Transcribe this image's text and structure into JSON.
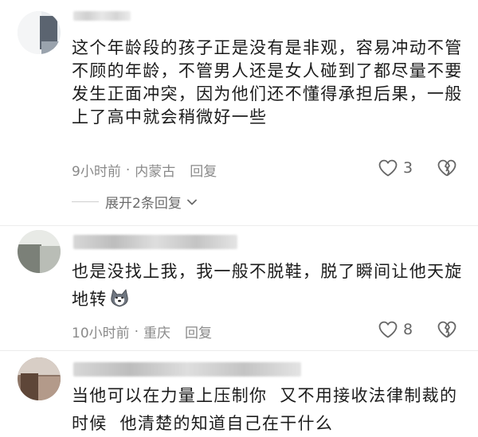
{
  "comments": [
    {
      "text_lines": [
        "这个年龄段的孩子正是没有是非观，容易冲动不管",
        "不顾的年龄，不管男人还是女人碰到了都尽量不要",
        "发生正面冲突，因为他们还不懂得承担后果，一般",
        "上了高中就会稍微好一些"
      ],
      "time": "9小时前",
      "location": "内蒙古",
      "reply_label": "回复",
      "likes": "3",
      "expand_label": "展开2条回复"
    },
    {
      "text_lines": [
        "也是没找上我，我一般不脱鞋，脱了瞬间让他天旋",
        "地转"
      ],
      "time": "10小时前",
      "location": "重庆",
      "reply_label": "回复",
      "likes": "8"
    },
    {
      "text_lines": [
        "当他可以在力量上压制你  又不用接收法律制裁的",
        "时候  他清楚的知道自己在干什么"
      ]
    }
  ],
  "separator": "·",
  "icons": {
    "like": "heart-outline-icon",
    "dislike": "broken-heart-outline-icon",
    "expand": "chevron-down-icon",
    "emoji": "husky-dog-emoji-icon"
  },
  "colors": {
    "meta_text": "#8a8a8a",
    "body_text": "#1c1c1c",
    "icon": "#666666"
  }
}
